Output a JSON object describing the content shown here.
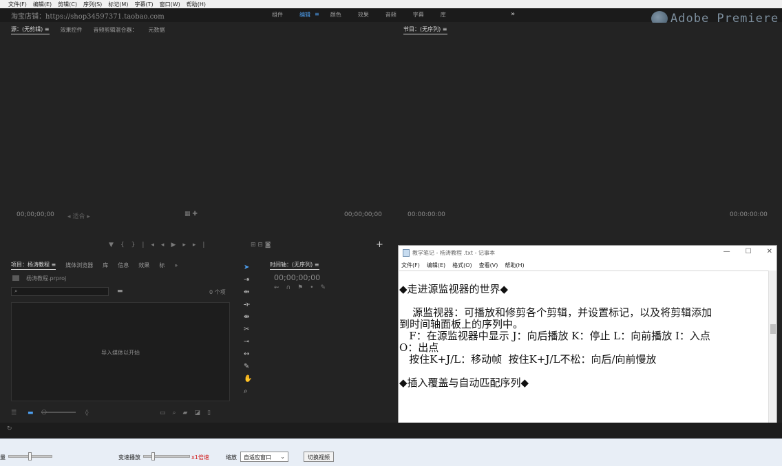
{
  "menubar": [
    "文件(F)",
    "编辑(E)",
    "剪辑(C)",
    "序列(S)",
    "标记(M)",
    "字幕(T)",
    "窗口(W)",
    "帮助(H)"
  ],
  "shop_text": "淘宝店铺：https://shop34597371.taobao.com",
  "workspaces": [
    "组件",
    "编辑",
    "颜色",
    "效果",
    "音频",
    "字幕",
    "库"
  ],
  "active_workspace": "编辑",
  "more": "»",
  "watermark": "Adobe Premiere",
  "source": {
    "tabs": [
      "源：(无剪辑) ≡",
      "效果控件",
      "音频剪辑混合器：",
      "元数据"
    ],
    "tc_left": "00;00;00;00",
    "fit": "◂ 适合 ▸",
    "tc_right": "00;00;00;00"
  },
  "program": {
    "tab": "节目：(无序列) ≡",
    "tc_left": "00:00:00:00",
    "tc_right": "00:00:00:00"
  },
  "project": {
    "tabs": [
      "项目：杨涛教程 ≡",
      "媒体浏览器",
      "库",
      "信息",
      "效果",
      "标",
      "»"
    ],
    "file": "杨涛教程.prproj",
    "items": "0 个项",
    "empty_hint": "导入媒体以开始"
  },
  "timeline": {
    "tab": "时间轴：(无序列) ≡",
    "tc": "00;00;00;00"
  },
  "notepad": {
    "title": "教学笔记 - 杨涛教程 .txt - 记事本",
    "menu": [
      "文件(F)",
      "编辑(E)",
      "格式(O)",
      "查看(V)",
      "帮助(H)"
    ],
    "lines": [
      "◆走进源监视器的世界◆",
      "    源监视器：可播放和修剪各个剪辑，并设置标记，以及将剪辑添加",
      "到时间轴面板上的序列中。",
      "   F：在源监视器中显示 J：向后播放 K：停止 L：向前播放 I：入点",
      "O：出点",
      "   按住K+J/L：移动帧  按住K+J/L不松：向后/向前慢放",
      "◆插入覆盖与自动匹配序列◆"
    ]
  },
  "player": {
    "volume_label": "量",
    "speed_label": "变速播放",
    "speed_value": "x1倍速",
    "zoom_label": "缩放",
    "zoom_option": "自适应窗口",
    "switch_button": "切换视频"
  }
}
